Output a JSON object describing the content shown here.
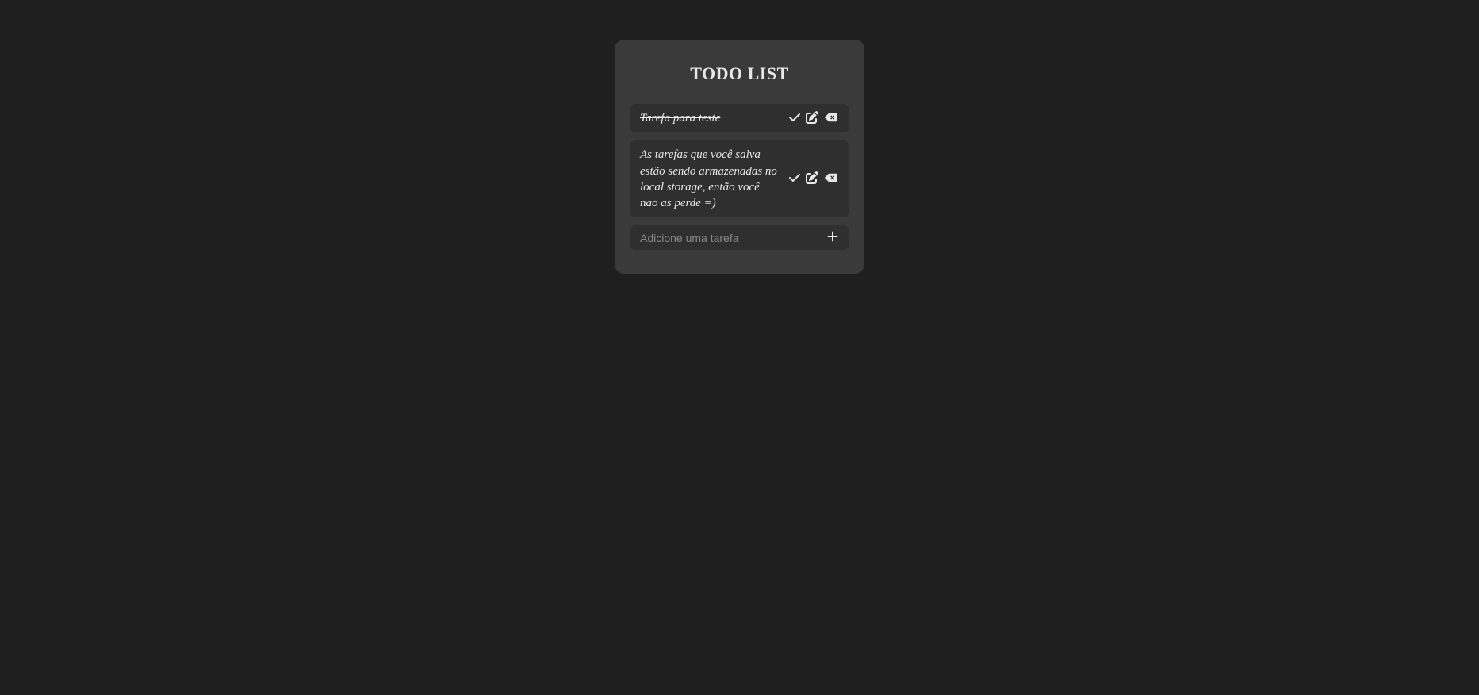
{
  "title": "TODO LIST",
  "tasks": [
    {
      "text": "Tarefa para teste",
      "completed": true
    },
    {
      "text": "As tarefas que você salva estão sendo armazenadas no local storage, então você nao as perde =)",
      "completed": false
    }
  ],
  "addPlaceholder": "Adicione uma tarefa"
}
